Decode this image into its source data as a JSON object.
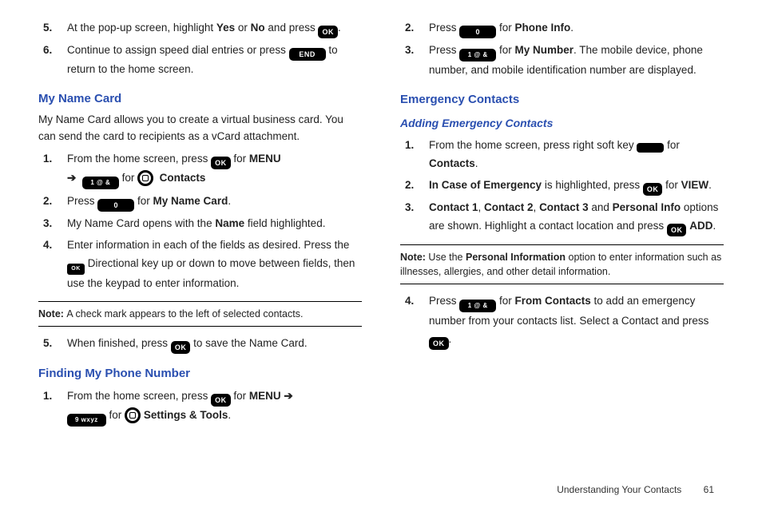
{
  "keys": {
    "ok": "OK",
    "end": "END",
    "num1": "1 @ &",
    "num0": "0",
    "num9": "9 wxyz",
    "dir": "OK"
  },
  "left": {
    "step5": {
      "num": "5.",
      "t1": "At the pop-up screen, highlight ",
      "yes": "Yes",
      "t2": " or ",
      "no": "No",
      "t3": " and press ",
      "t4": "."
    },
    "step6": {
      "num": "6.",
      "t1": "Continue to assign speed dial entries or press ",
      "t2": " to return to the home screen."
    },
    "myNameCard": {
      "heading": "My Name Card",
      "intro": "My Name Card allows you to create a virtual business card. You can send the card to recipients as a vCard attachment.",
      "s1": {
        "num": "1.",
        "t1": "From the home screen, press ",
        "menu": "MENU",
        "arrow": "➔",
        "for": " for ",
        "contacts": "Contacts"
      },
      "s2": {
        "num": "2.",
        "t1": " Press ",
        "t2": " for ",
        "label": "My Name Card",
        "t3": "."
      },
      "s3": {
        "num": "3.",
        "t1": "My Name Card opens with the ",
        "name": "Name",
        "t2": " field highlighted."
      },
      "s4": {
        "num": "4.",
        "t1": "Enter information in each of the fields as desired. Press the ",
        "t2": " Directional key up or down to move between fields, then use the keypad to enter information."
      },
      "note": {
        "label": "Note: ",
        "text": "A check mark appears to the left of selected contacts."
      },
      "s5": {
        "num": "5.",
        "t1": "When finished, press ",
        "t2": " to save the Name Card."
      }
    },
    "findNum": {
      "heading": "Finding My Phone Number",
      "s1": {
        "num": "1.",
        "t1": "From the home screen, press ",
        "t2": " for ",
        "menu": "MENU",
        "arrow": " ➔ ",
        "for2": " for ",
        "settings": "Settings & Tools",
        "t3": "."
      }
    }
  },
  "right": {
    "s2": {
      "num": "2.",
      "t1": "Press ",
      "t2": " for ",
      "label": "Phone Info",
      "t3": "."
    },
    "s3": {
      "num": "3.",
      "t1": "Press ",
      "t2": " for ",
      "label": "My Number",
      "t3": ". The mobile device, phone number, and mobile identification number are displayed."
    },
    "emergency": {
      "heading": "Emergency Contacts",
      "sub": "Adding Emergency Contacts",
      "s1": {
        "num": "1.",
        "t1": "From the home screen, press right soft key ",
        "t2": " for ",
        "contacts": "Contacts",
        "t3": "."
      },
      "s2": {
        "num": "2.",
        "ice": "In Case of Emergency",
        "t1": " is highlighted, press ",
        "t2": " for ",
        "view": "VIEW",
        "t3": "."
      },
      "s3": {
        "num": "3.",
        "c1": "Contact 1",
        "sep": ", ",
        "c2": "Contact 2",
        "c3": "Contact 3",
        "and": " and ",
        "pi": "Personal Info",
        "t1": " options are shown. Highlight a contact location and press ",
        "add": "ADD",
        "t2": "."
      },
      "note": {
        "label": "Note: ",
        "t1": "Use the ",
        "pi": "Personal Information",
        "t2": " option to enter information such as illnesses, allergies, and other detail information."
      },
      "s4": {
        "num": "4.",
        "t1": "Press ",
        "t2": " for ",
        "fc": "From Contacts",
        "t3": " to add an emergency number from your contacts list. Select a Contact and press ",
        "t4": "."
      }
    }
  },
  "footer": {
    "section": "Understanding Your Contacts",
    "page": "61"
  }
}
